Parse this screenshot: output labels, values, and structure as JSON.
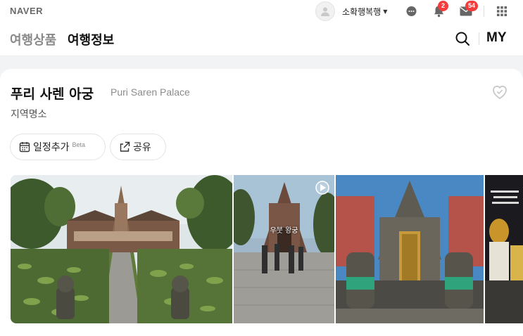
{
  "topbar": {
    "logo": "NAVER",
    "username": "소확행복행",
    "notifications_count": "2",
    "mail_count": "54"
  },
  "nav": {
    "tab_products": "여행상품",
    "tab_info": "여행정보",
    "my_label": "MY"
  },
  "place": {
    "title_ko": "푸리 사렌 아궁",
    "title_en": "Puri Saren Palace",
    "category": "지역명소"
  },
  "actions": {
    "add_schedule": "일정추가",
    "beta": "Beta",
    "share": "공유"
  },
  "photos": {
    "caption_2": "우붓 왕궁"
  },
  "colors": {
    "badge": "#f33c3c",
    "text_primary": "#111111",
    "text_muted": "#8c8c8c"
  },
  "icons": [
    "profile-icon",
    "chat-icon",
    "bell-icon",
    "mail-icon",
    "apps-grid-icon",
    "search-icon",
    "heart-icon",
    "calendar-icon",
    "share-icon",
    "video-play-icon"
  ]
}
